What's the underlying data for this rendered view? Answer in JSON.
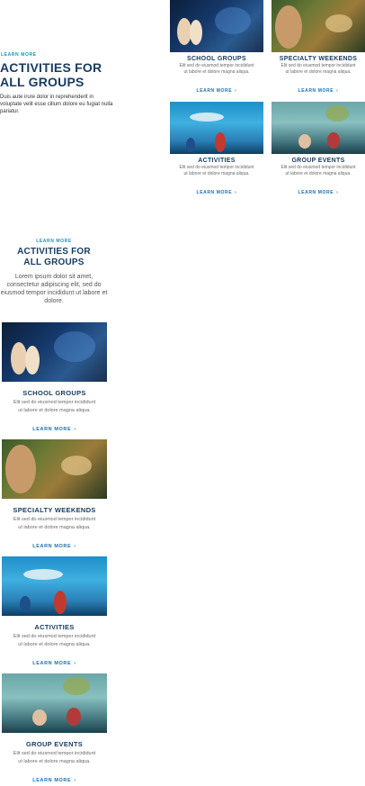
{
  "top": {
    "eyebrow": "LEARN MORE",
    "heading_line1": "ACTIVITIES FOR",
    "heading_line2": "ALL GROUPS",
    "description": "Duis aute irure dolor in reprehenderit in voluptate velit esse cillum dolore eu fugiat nulla pariatur."
  },
  "cards": [
    {
      "title": "SCHOOL GROUPS",
      "text1": "Elit sed do eiusmod tempor incididunt",
      "text2": "ut labore et dolore magna aliqua.",
      "link": "LEARN MORE"
    },
    {
      "title": "SPECIALTY WEEKENDS",
      "text1": "Elit sed do eiusmod tempor incididunt",
      "text2": "ut labore et dolore magna aliqua.",
      "link": "LEARN MORE"
    },
    {
      "title": "ACTIVITIES",
      "text1": "Elit sed do eiusmod tempor incididunt",
      "text2": "ut labore et dolore magna aliqua.",
      "link": "LEARN MORE"
    },
    {
      "title": "GROUP EVENTS",
      "text1": "Elit sed do eiusmod tempor incididunt",
      "text2": "ut labore et dolore magna aliqua.",
      "link": "LEARN MORE"
    }
  ],
  "mobile": {
    "eyebrow": "LEARN MORE",
    "heading_line1": "ACTIVITIES FOR",
    "heading_line2": "ALL GROUPS",
    "description": "Lorem ipsum dolor sit amet, consectetur adipiscing elit, sed do eiusmod tempor incididunt ut labore et dolore."
  },
  "chevron": "›"
}
